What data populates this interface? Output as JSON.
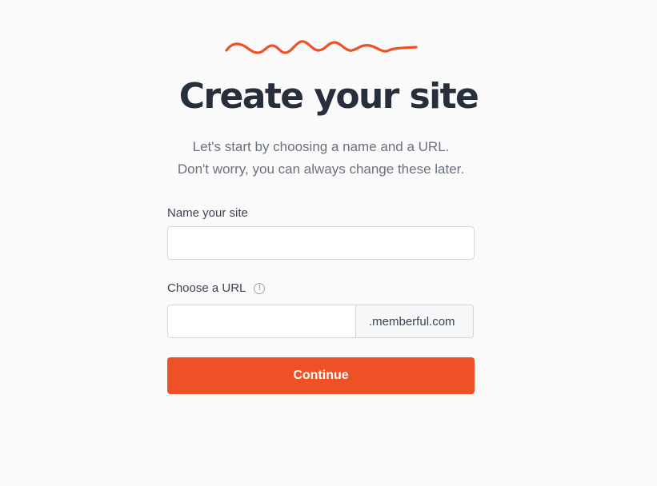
{
  "header": {
    "title": "Create your site",
    "subtitle_line1": "Let's start by choosing a name and a URL.",
    "subtitle_line2": "Don't worry, you can always change these later.",
    "decoration_icon": "squiggle-line",
    "accent_color": "#ef5127"
  },
  "form": {
    "name_label": "Name your site",
    "name_value": "",
    "name_placeholder": "",
    "url_label": "Choose a URL",
    "url_info_icon": "info-circle-icon",
    "url_info_glyph": "!",
    "url_value": "",
    "url_placeholder": "",
    "url_suffix": ".memberful.com",
    "continue_label": "Continue"
  }
}
